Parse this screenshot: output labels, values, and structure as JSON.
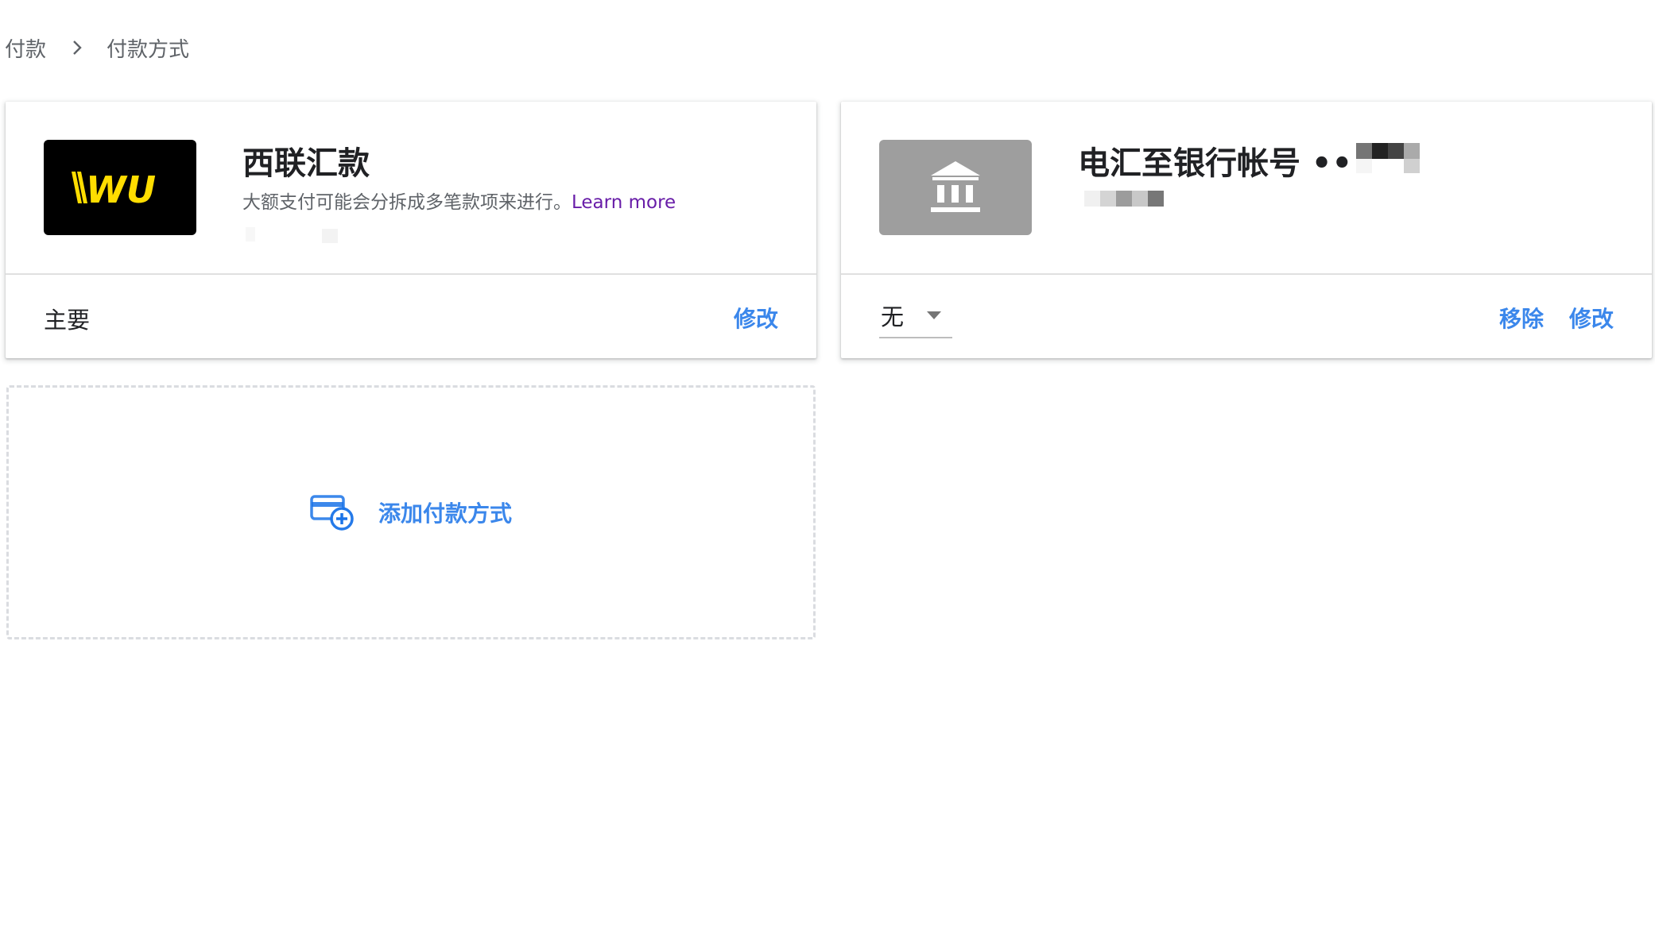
{
  "breadcrumb": {
    "root": "付款",
    "current": "付款方式"
  },
  "western_union": {
    "logo_text": "WU",
    "title": "西联汇款",
    "description": "大额支付可能会分拆成多笔款项来进行。",
    "learn_more": "Learn more",
    "status": "主要",
    "edit": "修改"
  },
  "bank_transfer": {
    "title": "电汇至银行帐号 •••",
    "select_value": "无",
    "remove": "移除",
    "edit": "修改"
  },
  "add_method": {
    "label": "添加付款方式"
  },
  "colors": {
    "link_blue": "#1a73e8",
    "learn_more_purple": "#681da8",
    "wu_yellow": "#ffdd00",
    "bank_gray": "#9e9e9e"
  },
  "icons": [
    "chevron-right-icon",
    "western-union-logo",
    "bank-icon",
    "add-card-icon",
    "caret-down-icon"
  ]
}
